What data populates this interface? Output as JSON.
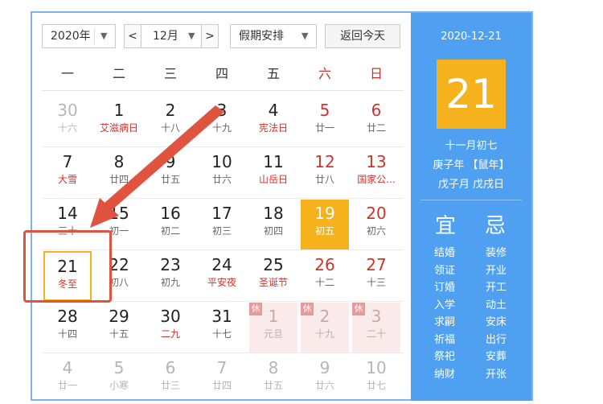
{
  "toolbar": {
    "year": "2020年",
    "prev": "<",
    "month": "12月",
    "next": ">",
    "holiday": "假期安排",
    "today": "返回今天",
    "caret": "▼"
  },
  "weekdays": [
    "一",
    "二",
    "三",
    "四",
    "五",
    "六",
    "日"
  ],
  "weeks": [
    [
      {
        "d": "30",
        "l": "十六",
        "other": true
      },
      {
        "d": "1",
        "l": "艾滋病日",
        "fest": true
      },
      {
        "d": "2",
        "l": "十八"
      },
      {
        "d": "3",
        "l": "十九"
      },
      {
        "d": "4",
        "l": "宪法日",
        "fest": true
      },
      {
        "d": "5",
        "l": "廿一"
      },
      {
        "d": "6",
        "l": "廿二"
      }
    ],
    [
      {
        "d": "7",
        "l": "大雪",
        "fest": true
      },
      {
        "d": "8",
        "l": "廿四"
      },
      {
        "d": "9",
        "l": "廿五"
      },
      {
        "d": "10",
        "l": "廿六"
      },
      {
        "d": "11",
        "l": "山岳日",
        "fest": true
      },
      {
        "d": "12",
        "l": "廿八"
      },
      {
        "d": "13",
        "l": "国家公...",
        "fest": true
      }
    ],
    [
      {
        "d": "14",
        "l": "三十"
      },
      {
        "d": "15",
        "l": "初一"
      },
      {
        "d": "16",
        "l": "初二"
      },
      {
        "d": "17",
        "l": "初三"
      },
      {
        "d": "18",
        "l": "初四"
      },
      {
        "d": "19",
        "l": "初五",
        "hl": true
      },
      {
        "d": "20",
        "l": "初六"
      }
    ],
    [
      {
        "d": "21",
        "l": "冬至",
        "fest": true,
        "sel": true
      },
      {
        "d": "22",
        "l": "初八"
      },
      {
        "d": "23",
        "l": "初九"
      },
      {
        "d": "24",
        "l": "平安夜",
        "fest": true
      },
      {
        "d": "25",
        "l": "圣诞节",
        "fest": true
      },
      {
        "d": "26",
        "l": "十二"
      },
      {
        "d": "27",
        "l": "十三"
      }
    ],
    [
      {
        "d": "28",
        "l": "十四"
      },
      {
        "d": "29",
        "l": "十五"
      },
      {
        "d": "30",
        "l": "二九",
        "fest": true
      },
      {
        "d": "31",
        "l": "十七"
      },
      {
        "d": "1",
        "l": "元旦",
        "holiday": true,
        "rest": "休"
      },
      {
        "d": "2",
        "l": "十九",
        "holiday": true,
        "rest": "休"
      },
      {
        "d": "3",
        "l": "二十",
        "holiday": true,
        "rest": "休"
      }
    ],
    [
      {
        "d": "4",
        "l": "廿一",
        "other": true
      },
      {
        "d": "5",
        "l": "小寒",
        "other": true
      },
      {
        "d": "6",
        "l": "廿三",
        "other": true
      },
      {
        "d": "7",
        "l": "廿四",
        "other": true
      },
      {
        "d": "8",
        "l": "廿五",
        "other": true
      },
      {
        "d": "9",
        "l": "廿六",
        "other": true
      },
      {
        "d": "10",
        "l": "廿七",
        "other": true
      }
    ]
  ],
  "side": {
    "date": "2020-12-21",
    "day": "21",
    "lunar": "十一月初七",
    "ganzhi_year": "庚子年 【鼠年】",
    "ganzhi_day": "戊子月 戊戌日",
    "yi": "宜",
    "ji": "忌",
    "yi_items": [
      "结婚",
      "领证",
      "订婚",
      "入学",
      "求嗣",
      "祈福",
      "祭祀",
      "纳财"
    ],
    "ji_items": [
      "装修",
      "开业",
      "开工",
      "动土",
      "安床",
      "出行",
      "安葬",
      "开张"
    ]
  },
  "colors": {
    "accent": "#4fa0f0",
    "highlight": "#f5b21c",
    "weekend_red": "#d0332c",
    "annotation": "#e0533e"
  }
}
